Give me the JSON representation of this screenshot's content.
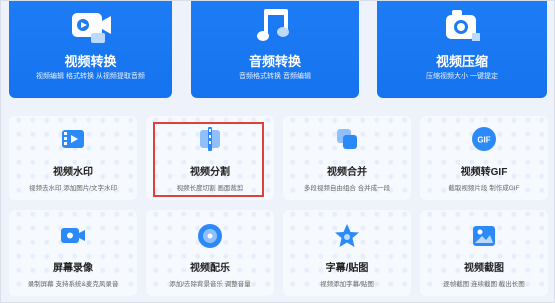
{
  "top_cards": [
    {
      "title": "视频转换",
      "subtitle": "视频编辑 格式转换 从视频提取音频",
      "icon": "video-convert-icon"
    },
    {
      "title": "音频转换",
      "subtitle": "音频格式转换 音频编辑",
      "icon": "music-note-icon"
    },
    {
      "title": "视频压缩",
      "subtitle": "压缩视频大小 一键提定",
      "icon": "video-compress-icon"
    }
  ],
  "tools": [
    {
      "title": "视频水印",
      "subtitle": "视频去水印 添加图片/文字水印",
      "icon": "film-watermark-icon"
    },
    {
      "title": "视频分割",
      "subtitle": "视频长度切割 画面裁剪",
      "icon": "video-split-icon"
    },
    {
      "title": "视频合并",
      "subtitle": "多段视频自由组合 合并成一段",
      "icon": "video-merge-icon"
    },
    {
      "title": "视频转GIF",
      "subtitle": "截取视频片段 制作成GIF",
      "icon": "gif-icon"
    },
    {
      "title": "屏幕录像",
      "subtitle": "录制屏幕 支持系统&麦克风录音",
      "icon": "screen-record-icon"
    },
    {
      "title": "视频配乐",
      "subtitle": "添加/去除背景音乐 调整音量",
      "icon": "music-disc-icon"
    },
    {
      "title": "字幕/贴图",
      "subtitle": "视频添加字幕/贴图",
      "icon": "star-sticker-icon"
    },
    {
      "title": "视频截图",
      "subtitle": "逐帧截图 连续截图 截出长图",
      "icon": "screenshot-icon"
    }
  ],
  "colors": {
    "accent": "#1d7cf5",
    "highlight": "#e0403a",
    "icon_blue": "#2b8af7"
  }
}
